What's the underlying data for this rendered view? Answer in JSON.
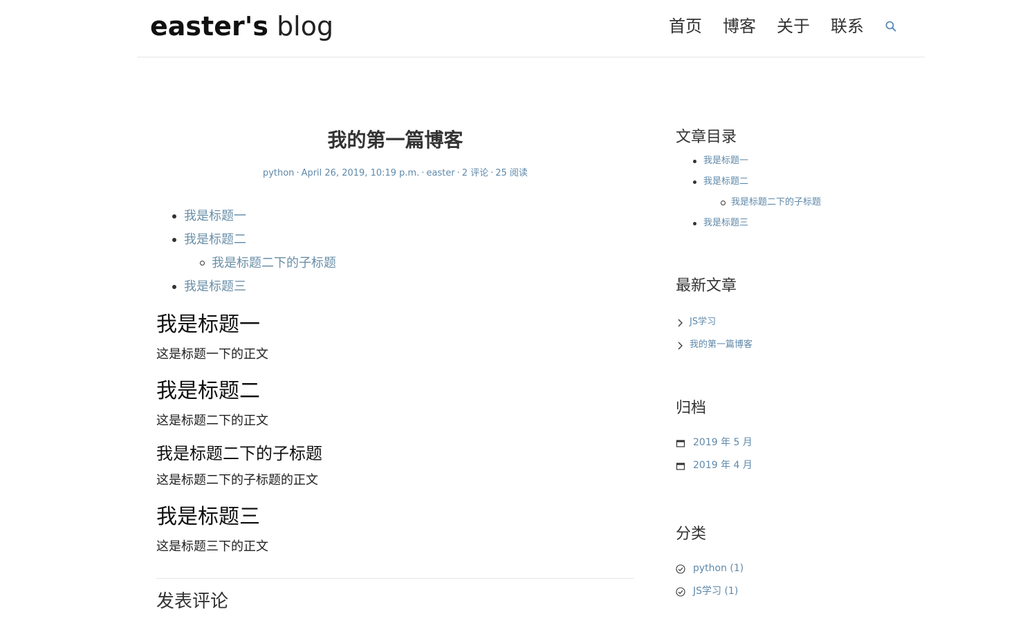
{
  "header": {
    "logo_bold": "easter's",
    "logo_light": "blog",
    "nav": [
      "首页",
      "博客",
      "关于",
      "联系"
    ],
    "search_icon": "search-icon"
  },
  "post": {
    "title": "我的第一篇博客",
    "meta": {
      "category": "python",
      "date": "April 26, 2019, 10:19 p.m.",
      "author": "easter",
      "comments": "2 评论",
      "views": "25 阅读"
    },
    "toc": {
      "item1": "我是标题一",
      "item2": "我是标题二",
      "item2_sub": "我是标题二下的子标题",
      "item3": "我是标题三"
    },
    "sections": [
      {
        "heading": "我是标题一",
        "body": "这是标题一下的正文"
      },
      {
        "heading": "我是标题二",
        "body": "这是标题二下的正文"
      },
      {
        "heading": "我是标题二下的子标题",
        "body": "这是标题二下的子标题的正文"
      },
      {
        "heading": "我是标题三",
        "body": "这是标题三下的正文"
      }
    ],
    "comment_title": "发表评论"
  },
  "sidebar": {
    "toc_title": "文章目录",
    "toc": {
      "item1": "我是标题一",
      "item2": "我是标题二",
      "item2_sub": "我是标题二下的子标题",
      "item3": "我是标题三"
    },
    "recent_title": "最新文章",
    "recent": [
      "JS学习",
      "我的第一篇博客"
    ],
    "archive_title": "归档",
    "archive": [
      "2019 年 5 月",
      "2019 年 4 月"
    ],
    "category_title": "分类",
    "categories": [
      "python (1)",
      "JS学习 (1)"
    ]
  },
  "colors": {
    "link": "#5f89aa",
    "text": "#222222",
    "divider": "#e6e6e6"
  }
}
